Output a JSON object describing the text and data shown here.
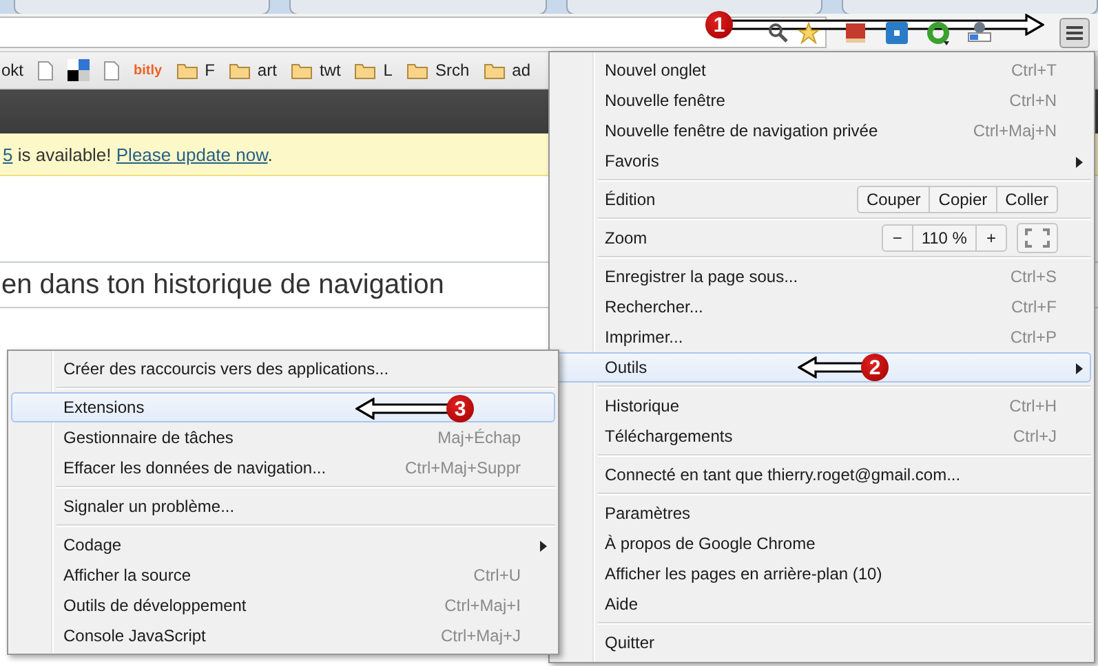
{
  "bookmarks": [
    {
      "kind": "text",
      "label": "okt"
    },
    {
      "kind": "page"
    },
    {
      "kind": "squares"
    },
    {
      "kind": "page"
    },
    {
      "kind": "logo",
      "label": "bitly"
    },
    {
      "kind": "folder",
      "label": "F"
    },
    {
      "kind": "folder",
      "label": "art"
    },
    {
      "kind": "folder",
      "label": "twt"
    },
    {
      "kind": "folder",
      "label": "L"
    },
    {
      "kind": "folder",
      "label": "Srch"
    },
    {
      "kind": "folder",
      "label": "ad"
    }
  ],
  "banner": [
    {
      "text": "5",
      "link": true
    },
    {
      "text": " is available! ",
      "link": false
    },
    {
      "text": "Please update now",
      "link": true
    },
    {
      "text": ".",
      "link": false
    }
  ],
  "heading": "en dans ton historique de navigation",
  "menu": {
    "items": [
      {
        "kind": "item",
        "label": "Nouvel onglet",
        "shortcut": "Ctrl+T",
        "submenu": false,
        "selected": false
      },
      {
        "kind": "item",
        "label": "Nouvelle fenêtre",
        "shortcut": "Ctrl+N",
        "submenu": false,
        "selected": false
      },
      {
        "kind": "item",
        "label": "Nouvelle fenêtre de navigation privée",
        "shortcut": "Ctrl+Maj+N",
        "submenu": false,
        "selected": false
      },
      {
        "kind": "item",
        "label": "Favoris",
        "submenu": true,
        "selected": false
      },
      {
        "kind": "separator"
      },
      {
        "kind": "edit",
        "label": "Édition",
        "buttons": [
          "Couper",
          "Copier",
          "Coller"
        ]
      },
      {
        "kind": "separator"
      },
      {
        "kind": "zoom",
        "label": "Zoom",
        "minus": "−",
        "value": "110 %",
        "plus": "+"
      },
      {
        "kind": "separator"
      },
      {
        "kind": "item",
        "label": "Enregistrer la page sous...",
        "shortcut": "Ctrl+S",
        "submenu": false,
        "selected": false
      },
      {
        "kind": "item",
        "label": "Rechercher...",
        "shortcut": "Ctrl+F",
        "submenu": false,
        "selected": false
      },
      {
        "kind": "item",
        "label": "Imprimer...",
        "shortcut": "Ctrl+P",
        "submenu": false,
        "selected": false
      },
      {
        "kind": "item",
        "label": "Outils",
        "submenu": true,
        "selected": true
      },
      {
        "kind": "separator"
      },
      {
        "kind": "item",
        "label": "Historique",
        "shortcut": "Ctrl+H",
        "submenu": false,
        "selected": false
      },
      {
        "kind": "item",
        "label": "Téléchargements",
        "shortcut": "Ctrl+J",
        "submenu": false,
        "selected": false
      },
      {
        "kind": "separator"
      },
      {
        "kind": "item",
        "label": "Connecté en tant que thierry.roget@gmail.com...",
        "submenu": false,
        "selected": false
      },
      {
        "kind": "separator"
      },
      {
        "kind": "item",
        "label": "Paramètres",
        "submenu": false,
        "selected": false
      },
      {
        "kind": "item",
        "label": "À propos de Google Chrome",
        "submenu": false,
        "selected": false
      },
      {
        "kind": "item",
        "label": "Afficher les pages en arrière-plan (10)",
        "submenu": false,
        "selected": false
      },
      {
        "kind": "item",
        "label": "Aide",
        "submenu": false,
        "selected": false
      },
      {
        "kind": "separator"
      },
      {
        "kind": "item",
        "label": "Quitter",
        "submenu": false,
        "selected": false
      }
    ]
  },
  "submenu": {
    "items": [
      {
        "kind": "item",
        "label": "Créer des raccourcis vers des applications...",
        "submenu": false,
        "selected": false
      },
      {
        "kind": "separator"
      },
      {
        "kind": "item",
        "label": "Extensions",
        "submenu": false,
        "selected": true
      },
      {
        "kind": "item",
        "label": "Gestionnaire de tâches",
        "shortcut": "Maj+Échap",
        "submenu": false,
        "selected": false
      },
      {
        "kind": "item",
        "label": "Effacer les données de navigation...",
        "shortcut": "Ctrl+Maj+Suppr",
        "submenu": false,
        "selected": false
      },
      {
        "kind": "separator"
      },
      {
        "kind": "item",
        "label": "Signaler un problème...",
        "submenu": false,
        "selected": false
      },
      {
        "kind": "separator"
      },
      {
        "kind": "item",
        "label": "Codage",
        "submenu": true,
        "selected": false
      },
      {
        "kind": "item",
        "label": "Afficher la source",
        "shortcut": "Ctrl+U",
        "submenu": false,
        "selected": false
      },
      {
        "kind": "item",
        "label": "Outils de développement",
        "shortcut": "Ctrl+Maj+I",
        "submenu": false,
        "selected": false
      },
      {
        "kind": "item",
        "label": "Console JavaScript",
        "shortcut": "Ctrl+Maj+J",
        "submenu": false,
        "selected": false
      }
    ]
  },
  "annotations": [
    {
      "number": "1",
      "kind": "rightward"
    },
    {
      "number": "2",
      "kind": "leftward"
    },
    {
      "number": "3",
      "kind": "leftward"
    }
  ]
}
